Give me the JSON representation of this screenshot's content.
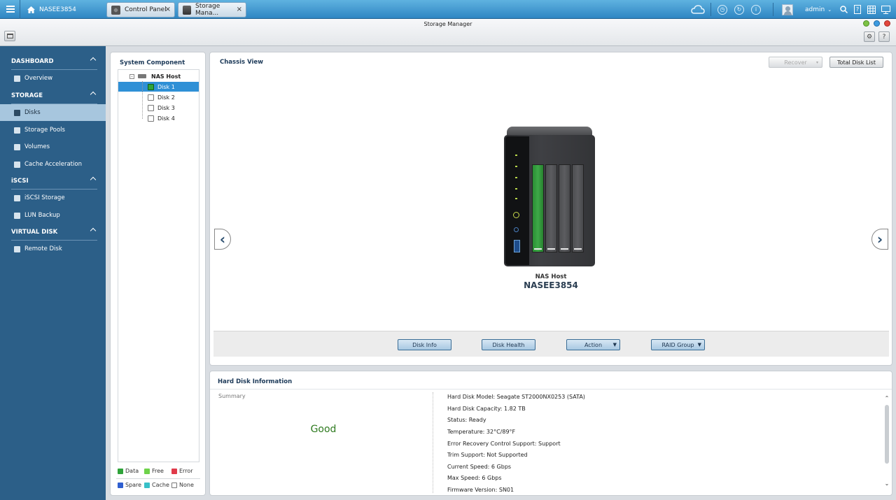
{
  "topbar": {
    "host": "NASEE3854",
    "tabs": [
      {
        "label": "Control Panel"
      },
      {
        "label": "Storage Mana..."
      }
    ],
    "user": "admin"
  },
  "window": {
    "title": "Storage Manager"
  },
  "sidebar": {
    "sections": [
      {
        "title": "DASHBOARD",
        "items": [
          {
            "label": "Overview"
          }
        ]
      },
      {
        "title": "STORAGE",
        "items": [
          {
            "label": "Disks"
          },
          {
            "label": "Storage Pools"
          },
          {
            "label": "Volumes"
          },
          {
            "label": "Cache Acceleration"
          }
        ]
      },
      {
        "title": "iSCSI",
        "items": [
          {
            "label": "iSCSI Storage"
          },
          {
            "label": "LUN Backup"
          }
        ]
      },
      {
        "title": "VIRTUAL DISK",
        "items": [
          {
            "label": "Remote Disk"
          }
        ]
      }
    ]
  },
  "system_component": {
    "title": "System Component",
    "root": "NAS Host",
    "disks": [
      "Disk 1",
      "Disk 2",
      "Disk 3",
      "Disk 4"
    ],
    "selected": "Disk 1",
    "legend": [
      {
        "label": "Data",
        "color": "#2fa33a"
      },
      {
        "label": "Free",
        "color": "#6ed24a"
      },
      {
        "label": "Error",
        "color": "#e03a4a"
      },
      {
        "label": "Spare",
        "color": "#2f5fd0"
      },
      {
        "label": "Cache",
        "color": "#38c0c8"
      },
      {
        "label": "None",
        "color": "#ffffff"
      }
    ]
  },
  "chassis": {
    "title": "Chassis View",
    "recover_label": "Recover",
    "total_disk_list_label": "Total Disk List",
    "device_label": "NAS Host",
    "device_name": "NASEE3854",
    "actions": {
      "disk_info": "Disk Info",
      "disk_health": "Disk Health",
      "action": "Action",
      "raid_group": "RAID Group"
    }
  },
  "hard_disk_info": {
    "title": "Hard Disk Information",
    "summary_label": "Summary",
    "status": "Good",
    "status_color": "#2e7a1f",
    "lines": [
      "Hard Disk Model: Seagate ST2000NX0253 (SATA)",
      "Hard Disk Capacity: 1.82 TB",
      "Status: Ready",
      "Temperature: 32°C/89°F",
      "Error Recovery Control Support: Support",
      "Trim Support: Not Supported",
      "Current Speed: 6 Gbps",
      "Max Speed: 6 Gbps",
      "Firmware Version: SN01"
    ]
  }
}
